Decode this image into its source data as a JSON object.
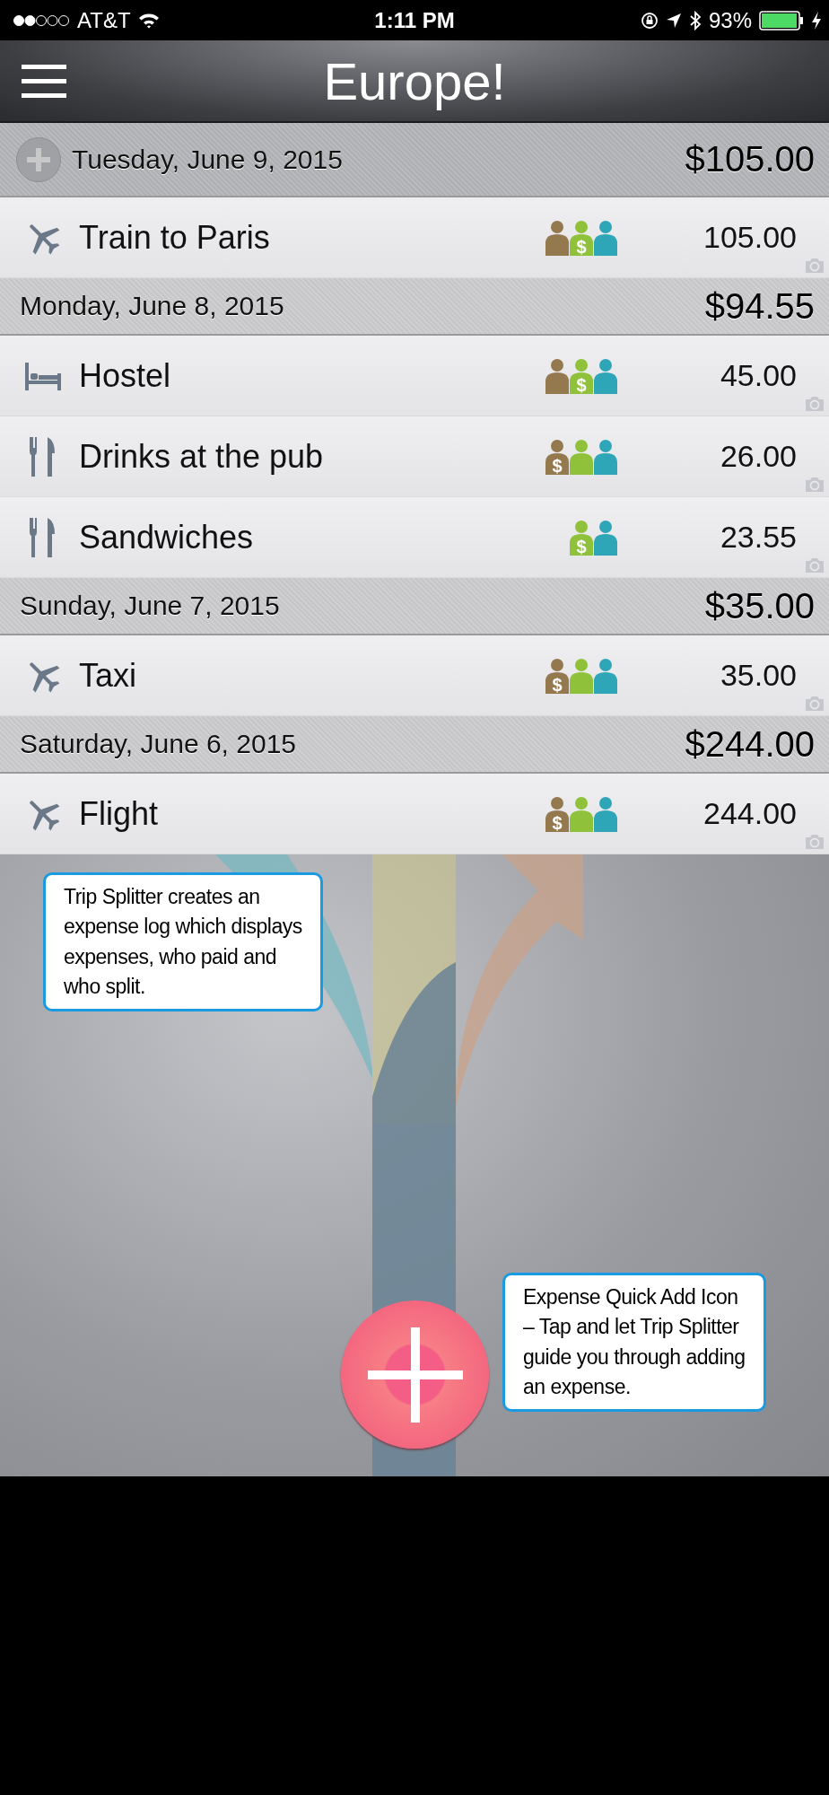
{
  "status_bar": {
    "carrier": "AT&T",
    "time": "1:11 PM",
    "battery": "93%"
  },
  "nav": {
    "title": "Europe!"
  },
  "days": [
    {
      "date": "Tuesday, June 9, 2015",
      "total": "$105.00",
      "add_button": true,
      "expenses": [
        {
          "kind": "plane",
          "name": "Train to Paris",
          "amount": "105.00",
          "people": [
            {
              "color": "#94784e"
            },
            {
              "color": "#8fc23a",
              "label": "$"
            },
            {
              "color": "#2fa6b8"
            }
          ]
        }
      ]
    },
    {
      "date": "Monday, June 8, 2015",
      "total": "$94.55",
      "add_button": false,
      "expenses": [
        {
          "kind": "bed",
          "name": "Hostel",
          "amount": "45.00",
          "people": [
            {
              "color": "#94784e"
            },
            {
              "color": "#8fc23a",
              "label": "$"
            },
            {
              "color": "#2fa6b8"
            }
          ]
        },
        {
          "kind": "utensils",
          "name": "Drinks at the pub",
          "amount": "26.00",
          "people": [
            {
              "color": "#94784e",
              "label": "$"
            },
            {
              "color": "#8fc23a"
            },
            {
              "color": "#2fa6b8"
            }
          ]
        },
        {
          "kind": "utensils",
          "name": "Sandwiches",
          "amount": "23.55",
          "people": [
            {
              "color": "#8fc23a",
              "label": "$"
            },
            {
              "color": "#2fa6b8"
            }
          ]
        }
      ]
    },
    {
      "date": "Sunday, June 7, 2015",
      "total": "$35.00",
      "add_button": false,
      "expenses": [
        {
          "kind": "plane",
          "name": "Taxi",
          "amount": "35.00",
          "people": [
            {
              "color": "#94784e",
              "label": "$"
            },
            {
              "color": "#8fc23a"
            },
            {
              "color": "#2fa6b8"
            }
          ]
        }
      ]
    },
    {
      "date": "Saturday, June 6, 2015",
      "total": "$244.00",
      "add_button": false,
      "expenses": [
        {
          "kind": "plane",
          "name": "Flight",
          "amount": "244.00",
          "people": [
            {
              "color": "#94784e",
              "label": "$"
            },
            {
              "color": "#8fc23a"
            },
            {
              "color": "#2fa6b8"
            }
          ]
        }
      ]
    }
  ],
  "callouts": [
    {
      "text": "Trip Splitter creates an expense log which displays expenses, who paid and who split."
    },
    {
      "text": "Expense Quick Add Icon – Tap and let Trip Splitter guide you through adding an expense."
    }
  ]
}
